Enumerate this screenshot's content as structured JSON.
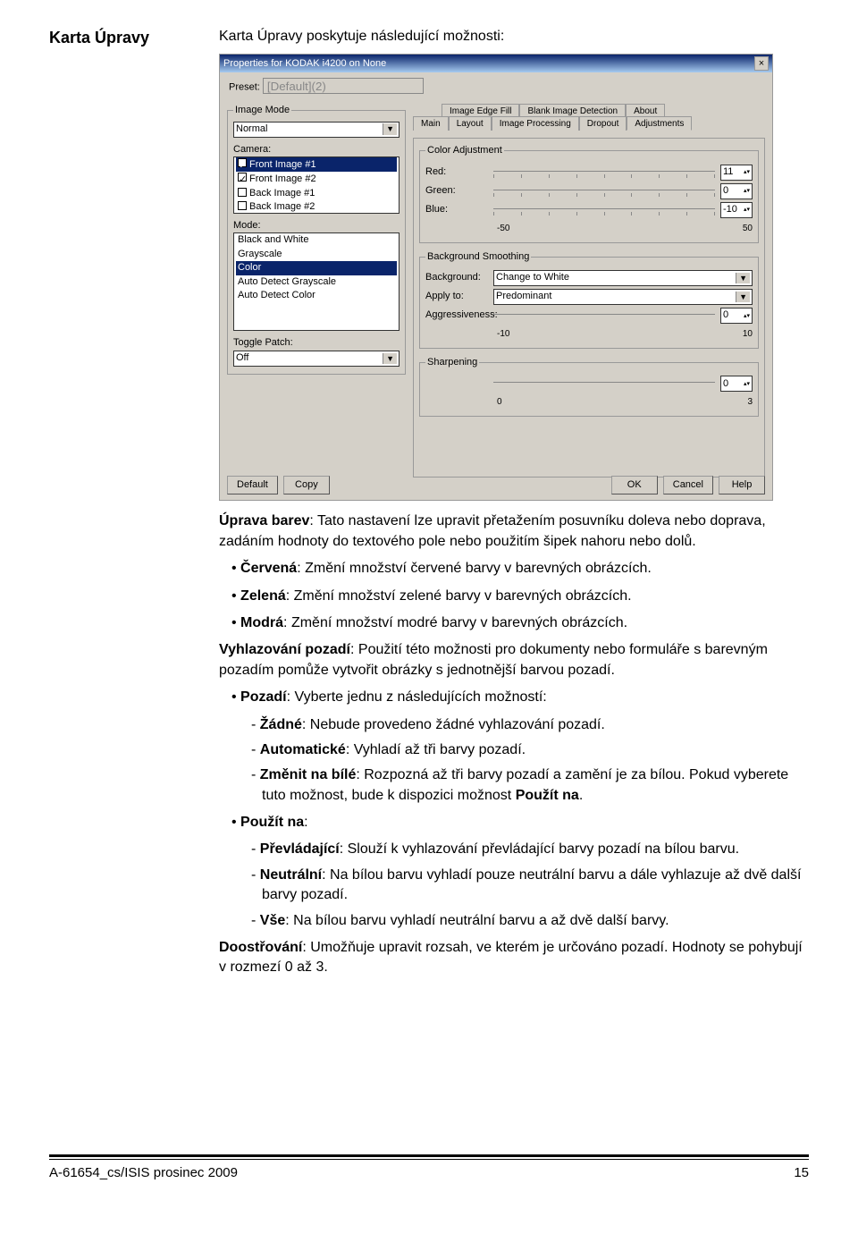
{
  "heading": "Karta Úpravy",
  "intro": "Karta Úpravy poskytuje následující možnosti:",
  "dialog": {
    "title": "Properties for KODAK i4200 on None",
    "preset_label": "Preset:",
    "preset_value": "[Default](2)",
    "image_mode": {
      "legend": "Image Mode",
      "combo": "Normal",
      "camera_label": "Camera:",
      "camera_items": [
        "Front Image #1",
        "Front Image #2",
        "Back Image #1",
        "Back Image #2"
      ],
      "mode_label": "Mode:",
      "mode_items": [
        "Black and White",
        "Grayscale",
        "Color",
        "Auto Detect Grayscale",
        "Auto Detect Color"
      ],
      "toggle_label": "Toggle Patch:",
      "toggle_value": "Off"
    },
    "tabs": {
      "row1": [
        "Image Edge Fill",
        "Blank Image Detection",
        "About"
      ],
      "row2": [
        "Main",
        "Layout",
        "Image Processing",
        "Dropout",
        "Adjustments"
      ]
    },
    "color_adj": {
      "legend": "Color Adjustment",
      "red_label": "Red:",
      "red_val": "11",
      "green_label": "Green:",
      "green_val": "0",
      "blue_label": "Blue:",
      "blue_val": "-10",
      "scale_min": "-50",
      "scale_max": "50"
    },
    "bg_smoothing": {
      "legend": "Background Smoothing",
      "bg_label": "Background:",
      "bg_val": "Change to White",
      "apply_label": "Apply to:",
      "apply_val": "Predominant",
      "aggr_label": "Aggressiveness:",
      "aggr_val": "0",
      "scale_min": "-10",
      "scale_max": "10"
    },
    "sharpening": {
      "legend": "Sharpening",
      "val": "0",
      "scale_min": "0",
      "scale_max": "3"
    },
    "buttons": {
      "default": "Default",
      "copy": "Copy",
      "ok": "OK",
      "cancel": "Cancel",
      "help": "Help"
    }
  },
  "text": {
    "p1a": "Úprava barev",
    "p1b": ": Tato nastavení lze upravit přetažením posuvníku doleva nebo doprava, zadáním hodnoty do textového pole nebo použitím šipek nahoru nebo dolů.",
    "b_red_a": "Červená",
    "b_red_b": ": Změní množství červené barvy v barevných obrázcích.",
    "b_green_a": "Zelená",
    "b_green_b": ": Změní množství zelené barvy v barevných obrázcích.",
    "b_blue_a": "Modrá",
    "b_blue_b": ": Změní množství modré barvy v barevných obrázcích.",
    "p2a": "Vyhlazování pozadí",
    "p2b": ": Použití této možnosti pro dokumenty nebo formuláře s barevným pozadím pomůže vytvořit obrázky s jednotnější barvou pozadí.",
    "b_bg_a": "Pozadí",
    "b_bg_b": ": Vyberte jednu z následujících možností:",
    "s_none_a": "Žádné",
    "s_none_b": ": Nebude provedeno žádné vyhlazování pozadí.",
    "s_auto_a": "Automatické",
    "s_auto_b": ": Vyhladí až tři barvy pozadí.",
    "s_white_a": "Změnit na bílé",
    "s_white_b": ": Rozpozná až tři barvy pozadí a zamění je za bílou. Pokud vyberete tuto možnost, bude k dispozici možnost ",
    "s_white_c": "Použít na",
    "s_white_d": ".",
    "b_apply_a": "Použít na",
    "b_apply_b": ":",
    "s_pred_a": "Převládající",
    "s_pred_b": ": Slouží k vyhlazování převládající barvy pozadí na bílou barvu.",
    "s_neut_a": "Neutrální",
    "s_neut_b": ": Na bílou barvu vyhladí pouze neutrální barvu a dále vyhlazuje až dvě další barvy pozadí.",
    "s_all_a": "Vše",
    "s_all_b": ": Na bílou barvu vyhladí neutrální barvu a až dvě další barvy.",
    "p3a": "Doostřování",
    "p3b": ": Umožňuje upravit rozsah, ve kterém je určováno pozadí. Hodnoty se pohybují v rozmezí 0 až 3."
  },
  "footer": {
    "left": "A-61654_cs/ISIS  prosinec 2009",
    "right": "15"
  }
}
